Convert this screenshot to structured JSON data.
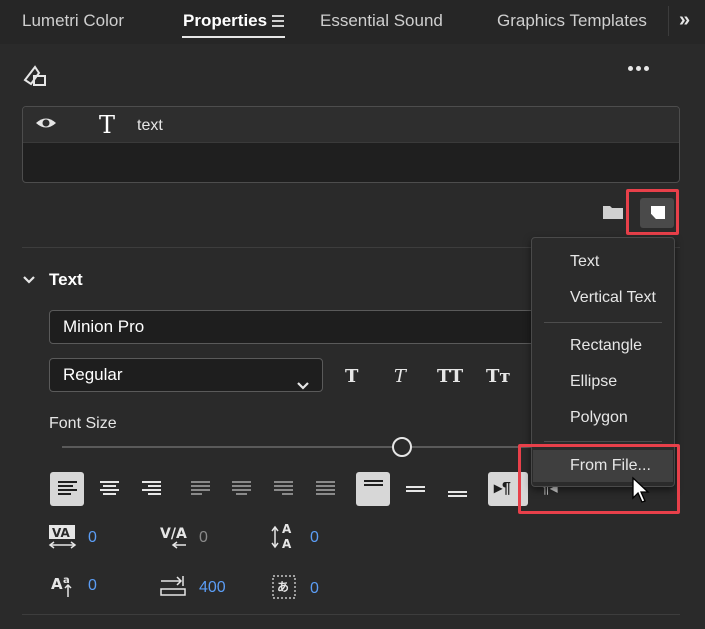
{
  "tabs": [
    {
      "label": "Lumetri Color"
    },
    {
      "label": "Properties"
    },
    {
      "label": "Essential Sound"
    },
    {
      "label": "Graphics Templates"
    }
  ],
  "layer": {
    "name": "text"
  },
  "section": {
    "title": "Text"
  },
  "font": {
    "family": "Minion Pro",
    "style": "Regular"
  },
  "style_buttons": [
    "T",
    "T",
    "TT",
    "Tт"
  ],
  "font_size_label": "Font Size",
  "font_size_level": 0.7,
  "metrics": {
    "kerning": "0",
    "tracking": "0",
    "leading": "0",
    "baseline": "0",
    "tab_width": "400",
    "tsume": "0"
  },
  "menu": {
    "items": [
      "Text",
      "Vertical Text",
      "Rectangle",
      "Ellipse",
      "Polygon",
      "From File..."
    ]
  },
  "colors": {
    "accent_blue": "#5b9df5",
    "highlight_red": "#e8404a"
  }
}
